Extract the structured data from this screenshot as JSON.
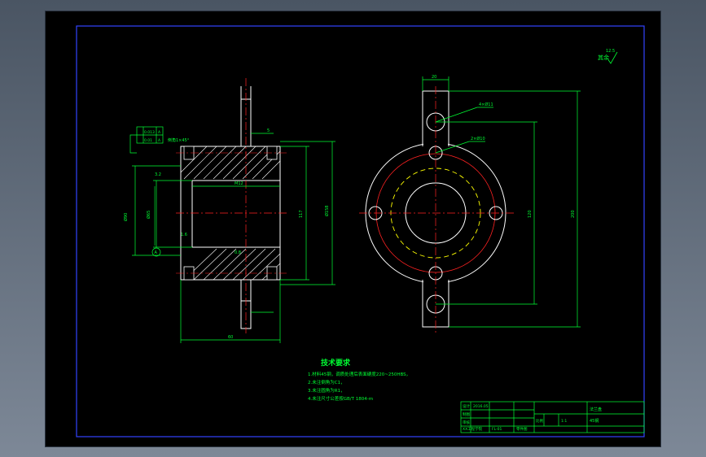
{
  "drawing": {
    "roughness_note": "其余",
    "roughness_value": "12.5",
    "section_marker": "A",
    "tolerance_box": [
      "0.013",
      "A",
      "0.01",
      "A"
    ],
    "dims_left": {
      "top_flange": "5",
      "bore_small": "Ø90",
      "bore_large": "Ø65",
      "height_inner": "117",
      "height_outer": "Ø158",
      "width": "60",
      "roughness_a": "3.2",
      "roughness_b": "1.6",
      "roughness_c": "0.8",
      "chamfer": "倒角1×45°",
      "thread": "M12"
    },
    "dims_right": {
      "top_width": "20",
      "hole_a": "4×Ø11",
      "hole_b": "2×Ø10",
      "height_mid": "120",
      "height_total": "200"
    }
  },
  "notes": {
    "title": "技术要求",
    "items": [
      "1.材料45钢，调质处理后表面硬度220~250HBS，",
      "2.未注倒角为C1，",
      "3.未注圆角为R1，",
      "4.未注尺寸公差按GB/T 1804-m"
    ]
  },
  "title_block": {
    "part_name": "法兰盘",
    "school": "XX工程学院",
    "material_label": "材料",
    "material": "45钢",
    "scale_label": "比例",
    "scale": "1:1",
    "designer_label": "设计",
    "drawn_label": "制图",
    "check_label": "审核",
    "date": "2016.05",
    "drawing_no": "FL-01",
    "remark": "零件图"
  }
}
